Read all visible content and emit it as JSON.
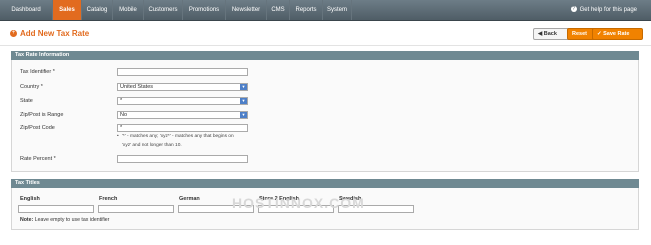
{
  "nav": {
    "items": [
      "Dashboard",
      "Sales",
      "Catalog",
      "Mobile",
      "Customers",
      "Promotions",
      "Newsletter",
      "CMS",
      "Reports",
      "System"
    ],
    "active": "Sales",
    "help": "Get help for this page"
  },
  "header": {
    "title": "Add New Tax Rate",
    "back": "Back",
    "reset": "Reset",
    "save": "Save Rate"
  },
  "tax_rate_information": {
    "title": "Tax Rate Information",
    "fields": {
      "tax_identifier": {
        "label": "Tax Identifier *",
        "value": ""
      },
      "country": {
        "label": "Country *",
        "value": "United States"
      },
      "state": {
        "label": "State",
        "value": "*"
      },
      "zip_is_range": {
        "label": "Zip/Post is Range",
        "value": "No"
      },
      "zip_code": {
        "label": "Zip/Post Code",
        "value": "*"
      },
      "rate_percent": {
        "label": "Rate Percent *",
        "value": ""
      }
    },
    "zip_note_1": "'*' - matches any; 'xyz*' - matches any that begins on",
    "zip_note_2": "'xyz' and not longer than 10."
  },
  "tax_titles": {
    "title": "Tax Titles",
    "columns": [
      "English",
      "French",
      "German",
      "Store 2 English",
      "Swedish"
    ],
    "note_label": "Note:",
    "note_text": "Leave empty to use tax identifier"
  },
  "watermark": "HOSTINNOX.COM",
  "colors": {
    "accent": "#e26b1f",
    "section_header": "#6f8992",
    "nav_bg": "#5e6d76"
  }
}
